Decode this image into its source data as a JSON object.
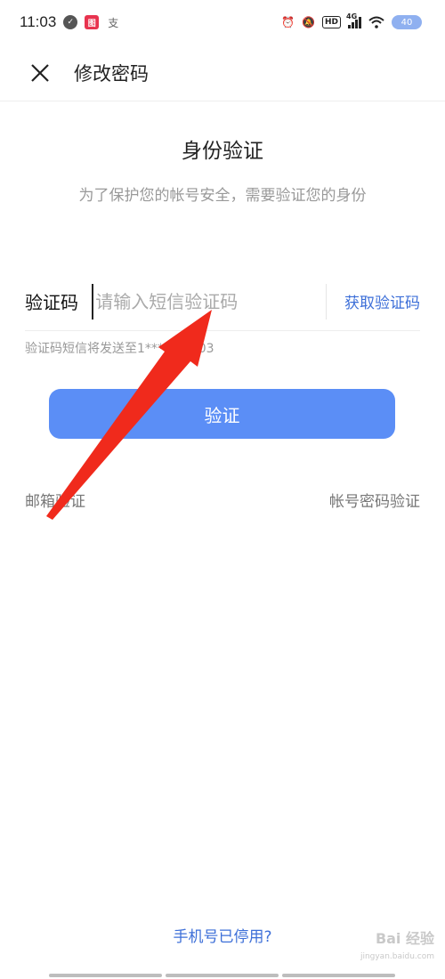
{
  "status_bar": {
    "time": "11:03",
    "network": "4G",
    "battery": "40"
  },
  "header": {
    "title": "修改密码"
  },
  "main": {
    "title": "身份验证",
    "subtitle": "为了保护您的帐号安全，需要验证您的身份",
    "code_label": "验证码",
    "code_value": "",
    "code_placeholder": "请输入短信验证码",
    "get_code": "获取验证码",
    "sms_hint": "验证码短信将发送至1******3903",
    "verify_button": "验证",
    "email_verify": "邮箱验证",
    "password_verify": "帐号密码验证",
    "phone_disabled": "手机号已停用?"
  },
  "watermark": {
    "logo": "Bai 经验",
    "url": "jingyan.baidu.com"
  },
  "colors": {
    "accent": "#5b8ef6",
    "link": "#3d6fd8",
    "annotation": "#f02a1c"
  }
}
